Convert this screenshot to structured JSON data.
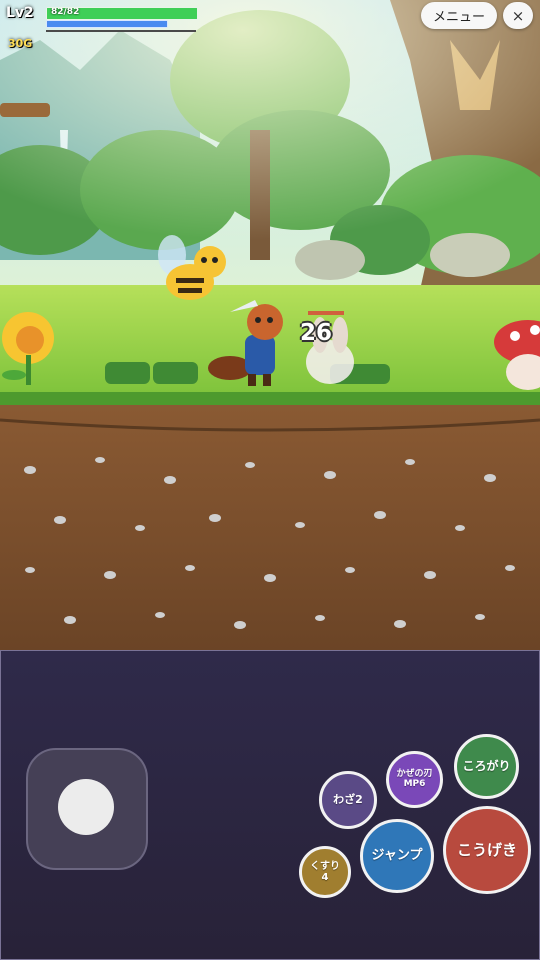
{
  "hud": {
    "level": "Lv2",
    "hp_text": "82/82",
    "hp_ratio": 1.0,
    "mp_ratio": 1.0,
    "xp_ratio": 0.0,
    "gold": "30G"
  },
  "top_right": {
    "menu_label": "メニュー",
    "close_label": "×"
  },
  "battle": {
    "damage_number": "26"
  },
  "controls": {
    "waza2": {
      "line1": "わざ2"
    },
    "kaze": {
      "line1": "かぜの刃",
      "line2": "MP6"
    },
    "korogari": {
      "line1": "ころがり"
    },
    "kusuri": {
      "line1": "くすり",
      "line2": "4"
    },
    "jump": {
      "line1": "ジャンプ"
    },
    "attack": {
      "line1": "こうげき"
    }
  },
  "colors": {
    "hp": "#3fcf57",
    "mp": "#4a8bf0",
    "attack": "#b84a3e",
    "jump": "#2f77b8",
    "roll": "#3f8a4c",
    "skill": "#7a48b8",
    "potion": "#a07e2f"
  }
}
